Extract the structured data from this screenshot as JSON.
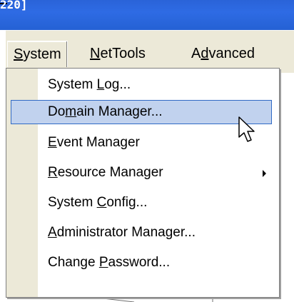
{
  "window": {
    "title_fragment": "220]"
  },
  "menubar": {
    "items": [
      {
        "pre": "",
        "accel": "S",
        "post": "ystem",
        "active": true
      },
      {
        "pre": "",
        "accel": "N",
        "post": "etTools",
        "active": false
      },
      {
        "pre": "A",
        "accel": "d",
        "post": "vanced",
        "active": false
      }
    ]
  },
  "dropdown": {
    "items": [
      {
        "pre": "System ",
        "accel": "L",
        "post": "og...",
        "highlighted": false,
        "submenu": false
      },
      {
        "pre": "Do",
        "accel": "m",
        "post": "ain Manager...",
        "highlighted": true,
        "submenu": false
      },
      {
        "pre": "",
        "accel": "E",
        "post": "vent Manager",
        "highlighted": false,
        "submenu": false
      },
      {
        "pre": "",
        "accel": "R",
        "post": "esource Manager",
        "highlighted": false,
        "submenu": true
      },
      {
        "pre": "System ",
        "accel": "C",
        "post": "onfig...",
        "highlighted": false,
        "submenu": false
      },
      {
        "pre": "",
        "accel": "A",
        "post": "dministrator Manager...",
        "highlighted": false,
        "submenu": false
      },
      {
        "pre": "Change ",
        "accel": "P",
        "post": "assword...",
        "highlighted": false,
        "submenu": false
      }
    ]
  },
  "colors": {
    "titlebar": "#2e6be4",
    "menu_bg": "#ece9d8",
    "highlight_bg": "#c1d2ee",
    "highlight_border": "#316ac5"
  },
  "icons": {
    "cursor": "mouse-pointer-icon",
    "submenu": "submenu-arrow-icon"
  }
}
